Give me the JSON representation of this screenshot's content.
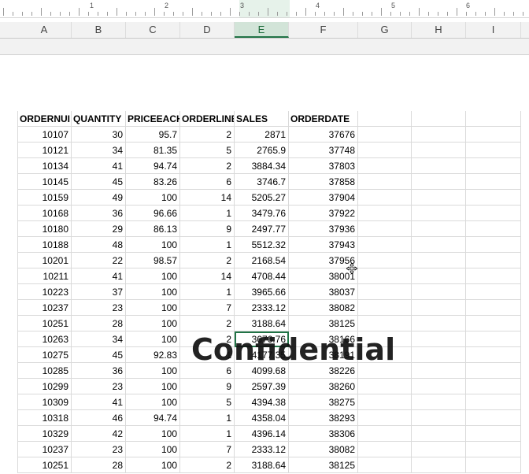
{
  "ruler": {
    "numbers": [
      "1",
      "2",
      "3",
      "4",
      "5",
      "6"
    ]
  },
  "columns": [
    "A",
    "B",
    "C",
    "D",
    "E",
    "F",
    "G",
    "H",
    "I"
  ],
  "selected_column": "E",
  "table": {
    "headers": [
      "ORDERNUI",
      "QUANTITY",
      "PRICEEACH",
      "ORDERLINE",
      "SALES",
      "ORDERDATE"
    ],
    "rows": [
      [
        "10107",
        "30",
        "95.7",
        "2",
        "2871",
        "37676"
      ],
      [
        "10121",
        "34",
        "81.35",
        "5",
        "2765.9",
        "37748"
      ],
      [
        "10134",
        "41",
        "94.74",
        "2",
        "3884.34",
        "37803"
      ],
      [
        "10145",
        "45",
        "83.26",
        "6",
        "3746.7",
        "37858"
      ],
      [
        "10159",
        "49",
        "100",
        "14",
        "5205.27",
        "37904"
      ],
      [
        "10168",
        "36",
        "96.66",
        "1",
        "3479.76",
        "37922"
      ],
      [
        "10180",
        "29",
        "86.13",
        "9",
        "2497.77",
        "37936"
      ],
      [
        "10188",
        "48",
        "100",
        "1",
        "5512.32",
        "37943"
      ],
      [
        "10201",
        "22",
        "98.57",
        "2",
        "2168.54",
        "37956"
      ],
      [
        "10211",
        "41",
        "100",
        "14",
        "4708.44",
        "38001"
      ],
      [
        "10223",
        "37",
        "100",
        "1",
        "3965.66",
        "38037"
      ],
      [
        "10237",
        "23",
        "100",
        "7",
        "2333.12",
        "38082"
      ],
      [
        "10251",
        "28",
        "100",
        "2",
        "3188.64",
        "38125"
      ],
      [
        "10263",
        "34",
        "100",
        "2",
        "3676.76",
        "38166"
      ],
      [
        "10275",
        "45",
        "92.83",
        "1",
        "4177.35",
        "38191"
      ],
      [
        "10285",
        "36",
        "100",
        "6",
        "4099.68",
        "38226"
      ],
      [
        "10299",
        "23",
        "100",
        "9",
        "2597.39",
        "38260"
      ],
      [
        "10309",
        "41",
        "100",
        "5",
        "4394.38",
        "38275"
      ],
      [
        "10318",
        "46",
        "94.74",
        "1",
        "4358.04",
        "38293"
      ],
      [
        "10329",
        "42",
        "100",
        "1",
        "4396.14",
        "38306"
      ],
      [
        "10237",
        "23",
        "100",
        "7",
        "2333.12",
        "38082"
      ],
      [
        "10251",
        "28",
        "100",
        "2",
        "3188.64",
        "38125"
      ]
    ]
  },
  "watermark": "Confidential",
  "colors": {
    "accent": "#217346",
    "grid": "#dadada",
    "header_bg": "#f2f2f2"
  },
  "icons": {
    "cursor": "move-cursor-icon"
  }
}
